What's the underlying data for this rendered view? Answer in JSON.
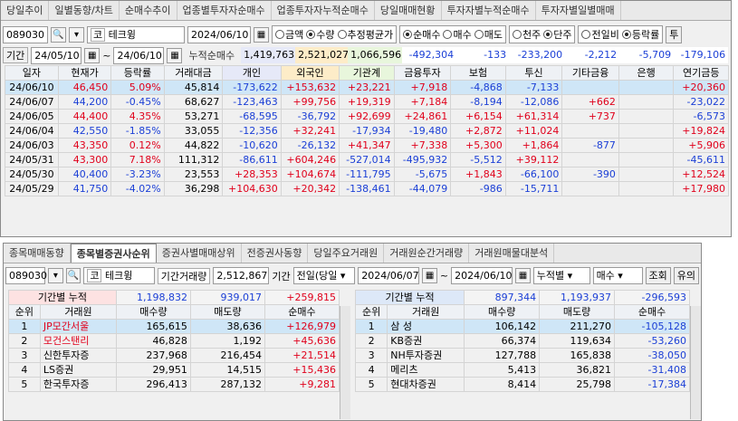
{
  "top": {
    "tabs": [
      "당일추이",
      "일별동향/차트",
      "순매수추이",
      "업종별투자자순매수",
      "업종투자자누적순매수",
      "당일매매현황",
      "투자자별누적순매수",
      "투자자별일별매매"
    ],
    "code": "089030",
    "stock_prefix": "코",
    "stock_name": "테크윙",
    "date": "2024/06/10",
    "radios1": [
      {
        "label": "금액",
        "on": false
      },
      {
        "label": "수량",
        "on": true
      },
      {
        "label": "추정평균가",
        "on": false
      }
    ],
    "radios2": [
      {
        "label": "순매수",
        "on": true
      },
      {
        "label": "매수",
        "on": false
      },
      {
        "label": "매도",
        "on": false
      }
    ],
    "radios3": [
      {
        "label": "천주",
        "on": false
      },
      {
        "label": "단주",
        "on": true
      }
    ],
    "radios4": [
      {
        "label": "전일비",
        "on": false
      },
      {
        "label": "등락률",
        "on": true
      }
    ],
    "last_btn": "투",
    "period_label": "기간",
    "from": "24/05/10",
    "to": "24/06/10",
    "cum_label": "누적순매수",
    "cum_values": [
      "1,419,763",
      "2,521,027",
      "1,066,596",
      "-492,304",
      "-133",
      "-233,200",
      "-2,212",
      "-5,709",
      "-179,106"
    ],
    "headers": [
      "일자",
      "현재가",
      "등락률",
      "거래대금",
      "개인",
      "외국인",
      "기관계",
      "금융투자",
      "보험",
      "투신",
      "기타금융",
      "은행",
      "연기금등"
    ],
    "rows": [
      [
        "24/06/10",
        "46,450",
        "5.09%",
        "45,814",
        "-173,622",
        "+153,632",
        "+23,221",
        "+7,918",
        "-4,868",
        "-7,133",
        "",
        "",
        "+20,360"
      ],
      [
        "24/06/07",
        "44,200",
        "-0.45%",
        "68,627",
        "-123,463",
        "+99,756",
        "+19,319",
        "+7,184",
        "-8,194",
        "-12,086",
        "+662",
        "",
        "-23,022"
      ],
      [
        "24/06/05",
        "44,400",
        "4.35%",
        "53,271",
        "-68,595",
        "-36,792",
        "+92,699",
        "+24,861",
        "+6,154",
        "+61,314",
        "+737",
        "",
        "-6,573"
      ],
      [
        "24/06/04",
        "42,550",
        "-1.85%",
        "33,055",
        "-12,356",
        "+32,241",
        "-17,934",
        "-19,480",
        "+2,872",
        "+11,024",
        "",
        "",
        "+19,824"
      ],
      [
        "24/06/03",
        "43,350",
        "0.12%",
        "44,822",
        "-10,620",
        "-26,132",
        "+41,347",
        "+7,338",
        "+5,300",
        "+1,864",
        "-877",
        "",
        "+5,906"
      ],
      [
        "24/05/31",
        "43,300",
        "7.18%",
        "111,312",
        "-86,611",
        "+604,246",
        "-527,014",
        "-495,932",
        "-5,512",
        "+39,112",
        "",
        "",
        "-45,611"
      ],
      [
        "24/05/30",
        "40,400",
        "-3.23%",
        "23,553",
        "+28,353",
        "+104,674",
        "-111,795",
        "-5,675",
        "+1,843",
        "-66,100",
        "-390",
        "",
        "+12,524"
      ],
      [
        "24/05/29",
        "41,750",
        "-4.02%",
        "36,298",
        "+104,630",
        "+20,342",
        "-138,461",
        "-44,079",
        "-986",
        "-15,711",
        "",
        "",
        "+17,980"
      ]
    ]
  },
  "bottom": {
    "tabs": [
      "종목매매동향",
      "종목별증권사순위",
      "증권사별매매상위",
      "전증권사동향",
      "당일주요거래원",
      "거래원순간거래량",
      "거래원매물대분석"
    ],
    "code": "089030",
    "stock_prefix": "코",
    "stock_name": "테크윙",
    "vol_label": "기간거래량",
    "vol_value": "2,512,867",
    "period_label": "기간",
    "period_select": "전일(당일",
    "from": "2024/06/07",
    "to": "2024/06/10",
    "mode_select": "누적별",
    "type_select": "매수",
    "query_btn": "조회",
    "note_btn": "유의",
    "left": {
      "sum_label": "기간별 누적",
      "sum_values": [
        "1,198,832",
        "939,017",
        "+259,815"
      ],
      "headers": [
        "순위",
        "거래원",
        "매수량",
        "매도량",
        "순매수"
      ],
      "rows": [
        [
          "1",
          "JP모간서울",
          "165,615",
          "38,636",
          "+126,979"
        ],
        [
          "2",
          "모건스탠리",
          "46,828",
          "1,192",
          "+45,636"
        ],
        [
          "3",
          "신한투자증",
          "237,968",
          "216,454",
          "+21,514"
        ],
        [
          "4",
          "LS증권",
          "29,951",
          "14,515",
          "+15,436"
        ],
        [
          "5",
          "한국투자증",
          "296,413",
          "287,132",
          "+9,281"
        ]
      ]
    },
    "right": {
      "sum_label": "기간별 누적",
      "sum_values": [
        "897,344",
        "1,193,937",
        "-296,593"
      ],
      "headers": [
        "순위",
        "거래원",
        "매수량",
        "매도량",
        "순매수"
      ],
      "rows": [
        [
          "1",
          "삼 성",
          "106,142",
          "211,270",
          "-105,128"
        ],
        [
          "2",
          "KB증권",
          "66,374",
          "119,634",
          "-53,260"
        ],
        [
          "3",
          "NH투자증권",
          "127,788",
          "165,838",
          "-38,050"
        ],
        [
          "4",
          "메리츠",
          "5,413",
          "36,821",
          "-31,408"
        ],
        [
          "5",
          "현대차증권",
          "8,414",
          "25,798",
          "-17,384"
        ]
      ]
    }
  }
}
